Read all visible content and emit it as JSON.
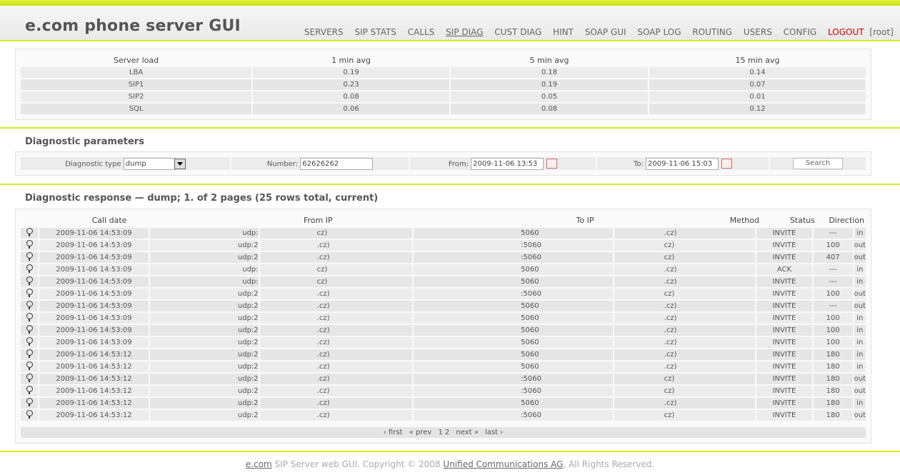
{
  "header": {
    "title": "e.com phone server GUI",
    "nav": [
      "SERVERS",
      "SIP STATS",
      "CALLS",
      "SIP DIAG",
      "CUST DIAG",
      "HINT",
      "SOAP GUI",
      "SOAP LOG",
      "ROUTING",
      "USERS",
      "CONFIG"
    ],
    "active": "SIP DIAG",
    "logout": "LOGOUT",
    "user": "[root]"
  },
  "load": {
    "headers": [
      "Server load",
      "1 min avg",
      "5 min avg",
      "15 min avg"
    ],
    "rows": [
      [
        "LBA",
        "0.19",
        "0.18",
        "0.14"
      ],
      [
        "SIP1",
        "0.23",
        "0.19",
        "0.07"
      ],
      [
        "SIP2",
        "0.08",
        "0.05",
        "0.01"
      ],
      [
        "SQL",
        "0.06",
        "0.08",
        "0.12"
      ]
    ]
  },
  "params": {
    "title": "Diagnostic parameters",
    "type_label": "Diagnostic type",
    "type_value": "dump",
    "number_label": "Number:",
    "number_value": "62626262",
    "from_label": "From:",
    "from_value": "2009-11-06 13:53",
    "to_label": "To:",
    "to_value": "2009-11-06 15:03",
    "search_label": "Search"
  },
  "response": {
    "title": "Diagnostic response — dump; 1. of 2 pages (25 rows total, current)",
    "headers": [
      "Call date",
      "From IP",
      "To IP",
      "Method",
      "Status",
      "Direction"
    ],
    "rows": [
      [
        "2009-11-06 14:53:09",
        "udp:",
        "cz)",
        "5060",
        ".cz)",
        "INVITE",
        "---",
        "in"
      ],
      [
        "2009-11-06 14:53:09",
        "udp:2",
        ".cz)",
        ":5060",
        "cz)",
        "INVITE",
        "100",
        "out"
      ],
      [
        "2009-11-06 14:53:09",
        "udp:2",
        ".cz)",
        ":5060",
        "cz)",
        "INVITE",
        "407",
        "out"
      ],
      [
        "2009-11-06 14:53:09",
        "udp:",
        "cz)",
        "5060",
        ".cz)",
        "ACK",
        "---",
        "in"
      ],
      [
        "2009-11-06 14:53:09",
        "udp:",
        "cz)",
        "5060",
        ".cz)",
        "INVITE",
        "---",
        "in"
      ],
      [
        "2009-11-06 14:53:09",
        "udp:2",
        ".cz)",
        ":5060",
        "cz)",
        "INVITE",
        "100",
        "out"
      ],
      [
        "2009-11-06 14:53:09",
        "udp:2",
        ".cz)",
        "5060",
        ".cz)",
        "INVITE",
        "---",
        "out"
      ],
      [
        "2009-11-06 14:53:09",
        "udp:2",
        ".cz)",
        "5060",
        ".cz)",
        "INVITE",
        "100",
        "in"
      ],
      [
        "2009-11-06 14:53:09",
        "udp:2",
        ".cz)",
        "5060",
        ".cz)",
        "INVITE",
        "100",
        "in"
      ],
      [
        "2009-11-06 14:53:09",
        "udp:2",
        ".cz)",
        "5060",
        ".cz)",
        "INVITE",
        "100",
        "in"
      ],
      [
        "2009-11-06 14:53:12",
        "udp:2",
        ".cz)",
        "5060",
        ".cz)",
        "INVITE",
        "180",
        "in"
      ],
      [
        "2009-11-06 14:53:12",
        "udp:2",
        ".cz)",
        "5060",
        ".cz)",
        "INVITE",
        "180",
        "in"
      ],
      [
        "2009-11-06 14:53:12",
        "udp:2",
        ".cz)",
        ":5060",
        "cz)",
        "INVITE",
        "180",
        "out"
      ],
      [
        "2009-11-06 14:53:12",
        "udp:2",
        ".cz)",
        ":5060",
        "cz)",
        "INVITE",
        "180",
        "out"
      ],
      [
        "2009-11-06 14:53:12",
        "udp:2",
        ".cz)",
        "5060",
        ".cz)",
        "INVITE",
        "180",
        "in"
      ],
      [
        "2009-11-06 14:53:12",
        "udp:2",
        ".cz)",
        ":5060",
        "cz)",
        "INVITE",
        "180",
        "out"
      ]
    ],
    "pager": {
      "first": "‹ first",
      "prev": "« prev",
      "page1": "1",
      "page2": "2",
      "next": "next »",
      "last": "last ›"
    }
  },
  "footer": {
    "brand": "e.com",
    "text1": " SIP Server web GUI. Copyright © 2008 ",
    "company": "Unified Communications AG",
    "text2": ", All Rights Reserved."
  }
}
